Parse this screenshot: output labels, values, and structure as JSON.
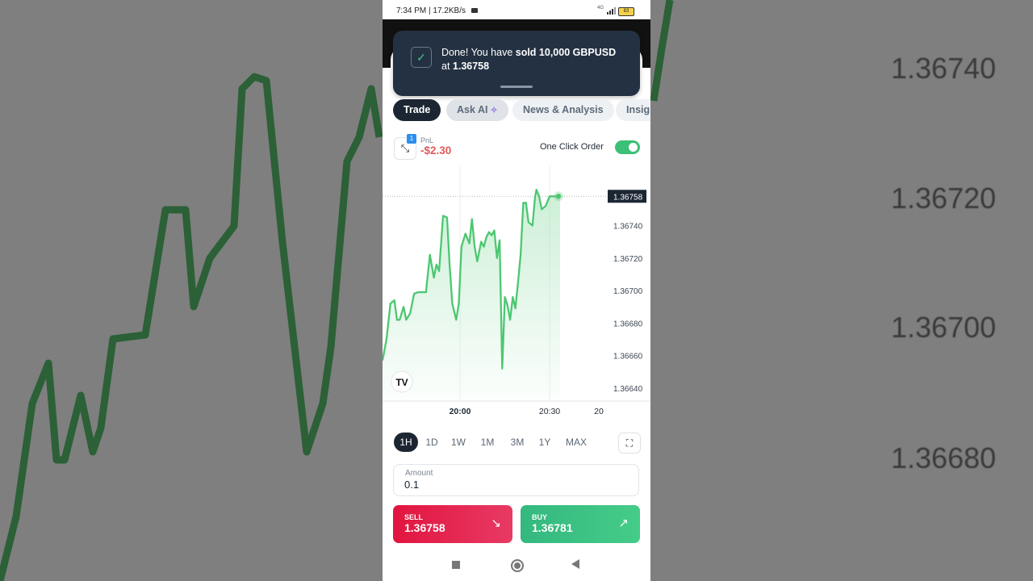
{
  "status_bar": {
    "time": "7:34 PM | 17.2KB/s",
    "battery": "83",
    "network": "4G"
  },
  "toast": {
    "prefix": "Done! You have ",
    "action": "sold 10,000 GBPUSD",
    "mid": " at ",
    "price": "1.36758"
  },
  "tabs": [
    {
      "label": "Trade"
    },
    {
      "label": "Ask AI"
    },
    {
      "label": "News & Analysis"
    },
    {
      "label": "Insig"
    }
  ],
  "pnl": {
    "badge": "1",
    "label": "PnL",
    "value": "-$2.30"
  },
  "one_click_order": {
    "label": "One Click Order",
    "enabled": true
  },
  "chart_data": {
    "type": "line",
    "y_ticks": [
      "1.36740",
      "1.36720",
      "1.36700",
      "1.36680",
      "1.36660",
      "1.36640"
    ],
    "y_tick_values": [
      1.3674,
      1.3672,
      1.367,
      1.3668,
      1.3666,
      1.3664
    ],
    "x_ticks": [
      "20:00",
      "20:30",
      "20"
    ],
    "current_price_label": "1.36758",
    "current_price": 1.36758,
    "ylim": [
      1.36632,
      1.36777
    ],
    "series": [
      {
        "color": "#4cc771",
        "x": [
          0,
          3,
          6,
          9,
          11,
          13,
          16,
          18,
          21,
          24,
          27,
          30,
          33,
          36,
          39,
          41,
          43,
          46,
          49,
          51,
          53,
          56,
          58,
          60,
          63,
          66,
          68,
          70,
          72,
          75,
          77,
          79,
          81,
          83,
          85,
          87,
          89,
          91,
          93,
          95,
          97,
          99,
          101,
          103,
          105,
          107,
          109,
          111,
          114,
          116,
          117,
          119,
          121,
          124,
          127,
          130,
          132,
          135
        ],
        "y": [
          1.36657,
          1.3667,
          1.36692,
          1.36694,
          1.36682,
          1.36682,
          1.3669,
          1.36682,
          1.36686,
          1.36698,
          1.36699,
          1.36699,
          1.36699,
          1.36722,
          1.36708,
          1.36716,
          1.36712,
          1.36746,
          1.36745,
          1.36716,
          1.36692,
          1.36682,
          1.36692,
          1.36727,
          1.36735,
          1.36729,
          1.36744,
          1.36727,
          1.36718,
          1.3673,
          1.36727,
          1.36733,
          1.36736,
          1.36734,
          1.36737,
          1.3672,
          1.36731,
          1.36652,
          1.36696,
          1.36691,
          1.36682,
          1.36696,
          1.36689,
          1.36705,
          1.36722,
          1.36754,
          1.36754,
          1.36742,
          1.3674,
          1.36758,
          1.36762,
          1.36758,
          1.3675,
          1.36752,
          1.36758,
          1.36758,
          1.36758,
          1.36758
        ]
      }
    ]
  },
  "timeframes": [
    {
      "label": "1H",
      "active": true
    },
    {
      "label": "1D"
    },
    {
      "label": "1W"
    },
    {
      "label": "1M"
    },
    {
      "label": "3M"
    },
    {
      "label": "1Y"
    },
    {
      "label": "MAX"
    }
  ],
  "amount": {
    "label": "Amount",
    "value": "0.1"
  },
  "sell": {
    "label": "SELL",
    "price": "1.36758"
  },
  "buy": {
    "label": "BUY",
    "price": "1.36781"
  },
  "background_prices": [
    "1.36740",
    "1.36720",
    "1.36700",
    "1.36680"
  ]
}
